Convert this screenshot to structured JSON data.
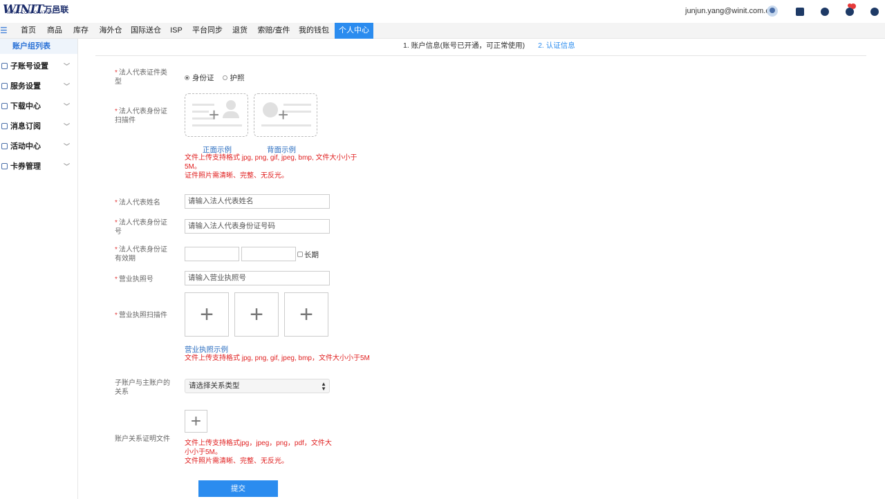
{
  "header": {
    "logo_mark": "WINIT",
    "logo_cn": "万邑联",
    "logo_sub": "WINIT CORPORATION",
    "user_email": "junjun.yang@winit.com.cn",
    "notification_count": "1"
  },
  "nav": {
    "items": [
      "首页",
      "商品",
      "库存",
      "海外仓",
      "国际送仓",
      "ISP",
      "平台同步",
      "退货",
      "索赔/查件",
      "我的钱包",
      "个人中心"
    ],
    "active_index": 10
  },
  "sidebar": {
    "header": "账户组列表",
    "items": [
      {
        "label": "子账号设置",
        "icon": "user-icon"
      },
      {
        "label": "服务设置",
        "icon": "heart-icon"
      },
      {
        "label": "下载中心",
        "icon": "download-icon"
      },
      {
        "label": "消息订阅",
        "icon": "message-icon"
      },
      {
        "label": "活动中心",
        "icon": "activity-icon"
      },
      {
        "label": "卡券管理",
        "icon": "coupon-icon"
      }
    ]
  },
  "steps": {
    "step1": "1. 账户信息(账号已开通，可正常使用)",
    "step2": "2. 认证信息"
  },
  "form": {
    "id_type_label": "法人代表证件类型",
    "id_type_options": [
      "身份证",
      "护照"
    ],
    "id_type_selected": "身份证",
    "id_scan_label": "法人代表身份证扫描件",
    "front_example": "正面示例",
    "back_example": "背面示例",
    "id_scan_hint_1": "文件上传支持格式 jpg, png, gif, jpeg, bmp, 文件大小小于",
    "id_scan_hint_2": "5M。",
    "id_scan_hint_3": "证件照片需清晰、完整、无反光。",
    "name_label": "法人代表姓名",
    "name_placeholder": "请输入法人代表姓名",
    "idno_label": "法人代表身份证号",
    "idno_placeholder": "请输入法人代表身份证号码",
    "validity_label": "法人代表身份证有效期",
    "validity_longterm": "长期",
    "license_no_label": "营业执照号",
    "license_no_placeholder": "请输入营业执照号",
    "license_scan_label": "营业执照扫描件",
    "license_example": "营业执照示例",
    "license_hint": "文件上传支持格式 jpg, png, gif, jpeg, bmp，文件大小小于5M",
    "relation_label": "子账户与主账户的关系",
    "relation_placeholder": "请选择关系类型",
    "relation_file_label": "账户关系证明文件",
    "relation_hint_1": "文件上传支持格式jpg，jpeg，png，pdf，文件大",
    "relation_hint_2": "小小于5M。",
    "relation_hint_3": "文件照片需清晰、完整、无反光。",
    "submit": "提交"
  },
  "colors": {
    "accent": "#2b8cef",
    "error": "#e02020",
    "link": "#2b6ec0"
  }
}
